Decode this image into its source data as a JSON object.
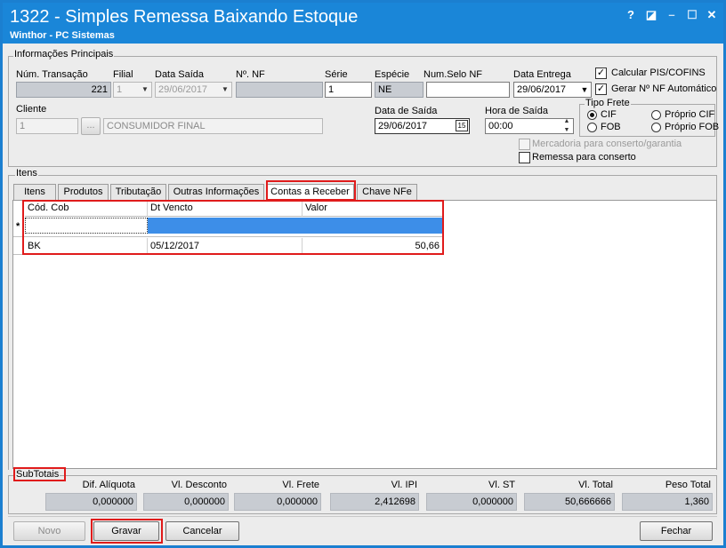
{
  "window": {
    "title": "1322 - Simples Remessa Baixando Estoque",
    "subtitle": "Winthor - PC Sistemas",
    "btn_help": "?",
    "btn_restore": "◪",
    "btn_minimize": "–",
    "btn_maximize": "☐",
    "btn_close": "✕"
  },
  "info": {
    "group_label": "Informações Principais",
    "num_transacao_label": "Núm. Transação",
    "num_transacao": "221",
    "filial_label": "Filial",
    "filial": "1",
    "data_saida_label": "Data Saída",
    "data_saida": "29/06/2017",
    "num_nf_label": "Nº. NF",
    "num_nf": "",
    "serie_label": "Série",
    "serie": "1",
    "especie_label": "Espécie",
    "especie": "NE",
    "num_selo_label": "Num.Selo NF",
    "num_selo": "",
    "data_entrega_label": "Data Entrega",
    "data_entrega": "29/06/2017",
    "calc_pis_label": "Calcular PIS/COFINS",
    "calc_pis_checked": "✓",
    "gerar_nf_label": "Gerar Nº NF Automático",
    "gerar_nf_checked": "✓",
    "cliente_label": "Cliente",
    "cliente_code": "1",
    "cliente_btn": "...",
    "cliente_name": "CONSUMIDOR FINAL",
    "data_de_saida_label": "Data de Saída",
    "data_de_saida": "29/06/2017",
    "cal_icon": "15",
    "hora_saida_label": "Hora de Saída",
    "hora_saida": "00:00",
    "tipo_frete_label": "Tipo Frete",
    "cif": "CIF",
    "fob": "FOB",
    "proprio_cif": "Próprio CIF",
    "proprio_fob": "Próprio FOB",
    "mercadoria_label": "Mercadoria para conserto/garantia",
    "remessa_label": "Remessa para conserto"
  },
  "itens": {
    "group_label": "Itens",
    "tabs": [
      {
        "label": "Itens"
      },
      {
        "label": "Produtos"
      },
      {
        "label": "Tributação"
      },
      {
        "label": "Outras Informações"
      },
      {
        "label": "Contas a Receber"
      },
      {
        "label": "Chave NFe"
      }
    ],
    "columns": [
      "Cód. Cob",
      "Dt Vencto",
      "Valor"
    ],
    "new_row_marker": "*",
    "rows": [
      {
        "cod": "BK",
        "vencto": "05/12/2017",
        "valor": "50,66"
      }
    ]
  },
  "subtotais": {
    "label": "SubTotais",
    "items": [
      {
        "label": "Dif. Alíquota",
        "value": "0,000000"
      },
      {
        "label": "Vl. Desconto",
        "value": "0,000000"
      },
      {
        "label": "Vl. Frete",
        "value": "0,000000"
      },
      {
        "label": "Vl. IPI",
        "value": "2,412698"
      },
      {
        "label": "Vl. ST",
        "value": "0,000000"
      },
      {
        "label": "Vl. Total",
        "value": "50,666666"
      },
      {
        "label": "Peso Total",
        "value": "1,360"
      }
    ]
  },
  "buttons": {
    "novo": "Novo",
    "gravar": "Gravar",
    "cancelar": "Cancelar",
    "fechar": "Fechar"
  }
}
